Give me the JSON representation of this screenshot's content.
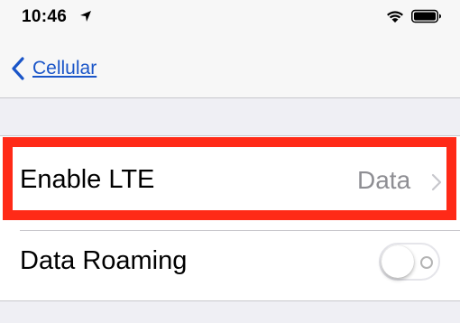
{
  "status_bar": {
    "time": "10:46",
    "icons": [
      "location-arrow-icon",
      "wifi-icon",
      "battery-icon"
    ]
  },
  "nav": {
    "back_label": "Cellular",
    "back_icon": "chevron-left-icon",
    "accent_color": "#1a55c8"
  },
  "rows": {
    "enable_lte": {
      "label": "Enable LTE",
      "value": "Data",
      "icon": "chevron-right-icon"
    },
    "data_roaming": {
      "label": "Data Roaming",
      "toggle_on": false
    }
  },
  "highlight": {
    "target": "enable-lte-row",
    "color": "#ff2a17"
  }
}
